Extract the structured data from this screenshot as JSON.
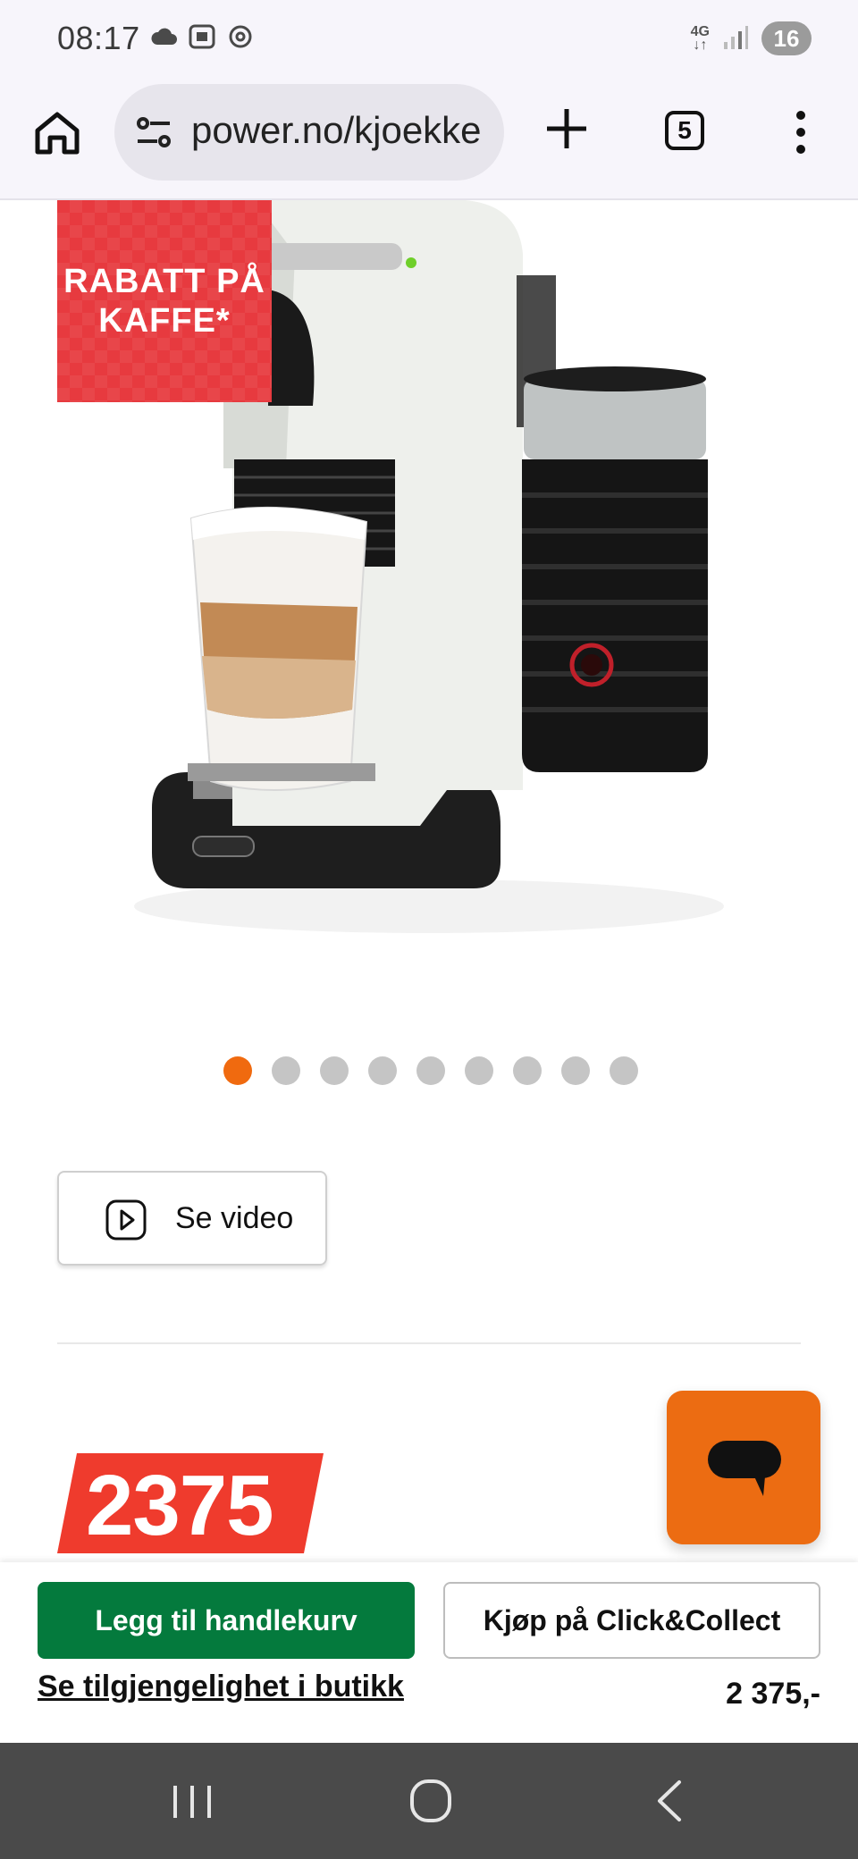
{
  "status_bar": {
    "time": "08:17",
    "network": "4G",
    "battery": "16",
    "icons": [
      "cloud-icon",
      "screenshot-icon",
      "threads-icon",
      "signal-icon"
    ]
  },
  "browser": {
    "url": "power.no/kjoekke",
    "tab_count": "5",
    "icons": [
      "home-icon",
      "site-settings-icon",
      "new-tab-icon",
      "more-icon"
    ]
  },
  "product": {
    "badge_line1": "RABATT PÅ",
    "badge_line2": "KAFFE",
    "badge_star": "*",
    "image_alt": "De'Longhi Nespresso Citiz & Milk coffee machine",
    "carousel": {
      "total": 9,
      "active_index": 0
    },
    "video_label": "Se video",
    "price": "2375"
  },
  "chat": {
    "icon": "chat-bubble-icon"
  },
  "bottom_bar": {
    "add_to_cart": "Legg til handlekurv",
    "click_collect": "Kjøp på Click&Collect",
    "availability_link": "Se tilgjengelighet i butikk",
    "price": "2 375,-"
  },
  "colors": {
    "accent_orange": "#ec6c12",
    "cart_green": "#047a3d",
    "badge_red": "#e73a3f",
    "price_red": "#ef3b2d"
  }
}
